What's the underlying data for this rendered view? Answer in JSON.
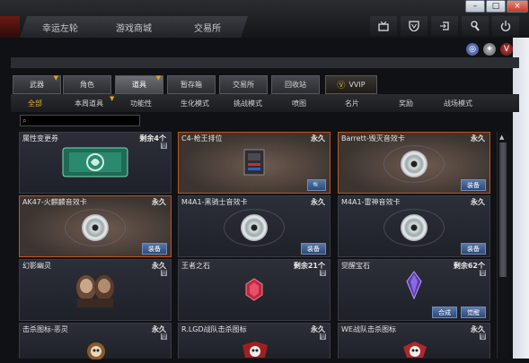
{
  "window": {
    "buttons": [
      {
        "icon": "minimize-icon",
        "glyph": "–"
      },
      {
        "icon": "restore-icon",
        "glyph": "□"
      },
      {
        "icon": "close-icon",
        "glyph": "×"
      }
    ]
  },
  "top_tabs": [
    "幸运左轮",
    "游戏商城",
    "交易所"
  ],
  "top_icons": [
    "tv-icon",
    "shield-icon",
    "exit-icon",
    "wrench-icon",
    "power-icon"
  ],
  "small_icons": [
    "globe-icon",
    "badge-icon",
    "v-logo-icon"
  ],
  "categories": [
    "武器",
    "角色",
    "道具",
    "暂存箱",
    "交易所",
    "回收站",
    "VVIP"
  ],
  "active_category": "道具",
  "subtabs": [
    "全部",
    "本周道具",
    "功能性",
    "生化模式",
    "挑战模式",
    "喷图",
    "名片",
    "奖励",
    "战场模式"
  ],
  "active_subtab": "全部",
  "search": {
    "placeholder": ""
  },
  "items": [
    {
      "name": "属性变更券",
      "duration": "剩余4个",
      "trash": true,
      "buttons": [],
      "pic": "ticket",
      "selected": false
    },
    {
      "name": "C4-枪王排位",
      "duration": "永久",
      "trash": false,
      "buttons": [
        "magnify"
      ],
      "pic": "c4",
      "selected": true
    },
    {
      "name": "Barrett-毁灭音效卡",
      "duration": "永久",
      "trash": false,
      "buttons": [
        "装备"
      ],
      "pic": "disc",
      "selected": true
    },
    {
      "name": "AK47-火麒麟音效卡",
      "duration": "永久",
      "trash": false,
      "buttons": [
        "装备"
      ],
      "pic": "disc",
      "selected": true
    },
    {
      "name": "M4A1-黑骑士音效卡",
      "duration": "永久",
      "trash": false,
      "buttons": [
        "装备"
      ],
      "pic": "disc",
      "selected": false
    },
    {
      "name": "M4A1-雷神音效卡",
      "duration": "永久",
      "trash": false,
      "buttons": [
        "装备"
      ],
      "pic": "disc",
      "selected": false
    },
    {
      "name": "幻影幽灵",
      "duration": "永久",
      "trash": true,
      "buttons": [],
      "pic": "ghost",
      "selected": false
    },
    {
      "name": "王者之石",
      "duration": "剩余21个",
      "trash": true,
      "buttons": [],
      "pic": "redgem",
      "selected": false
    },
    {
      "name": "觉醒宝石",
      "duration": "剩余62个",
      "trash": true,
      "buttons": [
        "合成",
        "觉醒"
      ],
      "pic": "purplegem",
      "selected": false
    },
    {
      "name": "击杀图标-恶灵",
      "duration": "永久",
      "trash": true,
      "buttons": [],
      "pic": "skull",
      "selected": false
    },
    {
      "name": "R.LGD战队击杀图标",
      "duration": "永久",
      "trash": true,
      "buttons": [],
      "pic": "skull2",
      "selected": false
    },
    {
      "name": "WE战队击杀图标",
      "duration": "永久",
      "trash": true,
      "buttons": [],
      "pic": "skull3",
      "selected": false
    }
  ],
  "magnify_glyph": "🔍",
  "trash_glyph": "🗑",
  "colors": {
    "accent": "#e6b13a",
    "selected_border": "#c0551e",
    "button_blue": "#2d4a78"
  }
}
